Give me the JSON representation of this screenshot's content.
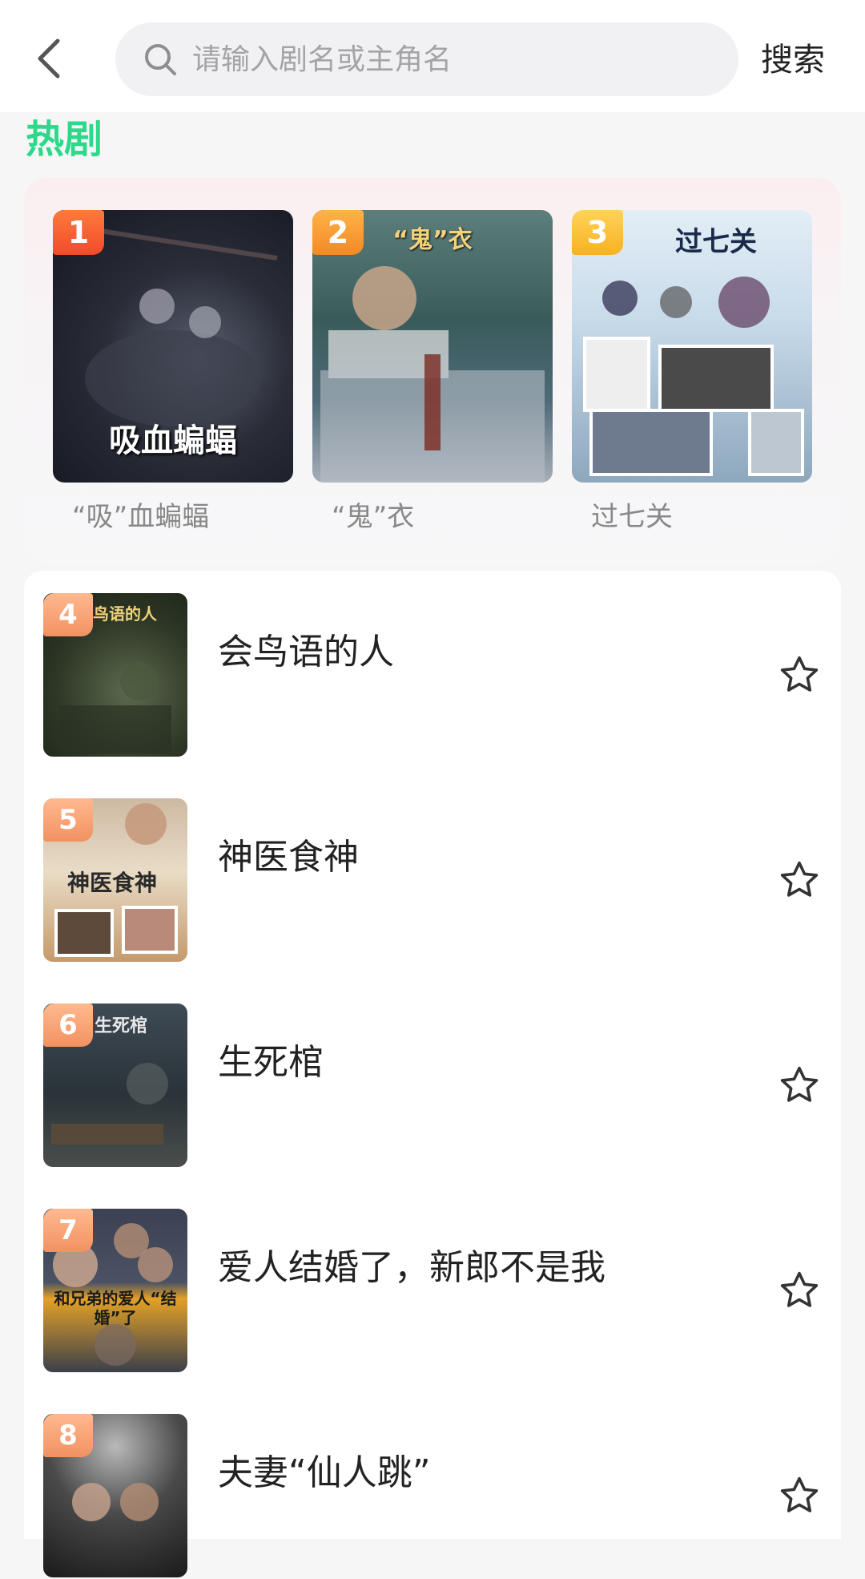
{
  "search": {
    "placeholder": "请输入剧名或主角名",
    "button_label": "搜索"
  },
  "section": {
    "title": "热剧"
  },
  "hot": [
    {
      "rank": "1",
      "name": "“吸”血蝙蝠",
      "poster_text": "吸血蝙蝠"
    },
    {
      "rank": "2",
      "name": "“鬼”衣",
      "poster_text": "“鬼”衣"
    },
    {
      "rank": "3",
      "name": "过七关",
      "poster_text": "过七关"
    }
  ],
  "list": [
    {
      "rank": "4",
      "title": "会鸟语的人",
      "poster_text": "鸟语的人"
    },
    {
      "rank": "5",
      "title": "神医食神",
      "poster_text": "神医食神"
    },
    {
      "rank": "6",
      "title": "生死棺",
      "poster_text": "生死棺"
    },
    {
      "rank": "7",
      "title": "爱人结婚了，新郎不是我",
      "poster_text": "和兄弟的爱人“结婚”了"
    },
    {
      "rank": "8",
      "title": "夫妻“仙人跳”",
      "poster_text": ""
    }
  ],
  "icons": {
    "back": "chevron-left-icon",
    "search": "search-icon",
    "favorite": "star-outline-icon"
  },
  "colors": {
    "accent": "#2bd98a",
    "badge": "#f48a24"
  }
}
